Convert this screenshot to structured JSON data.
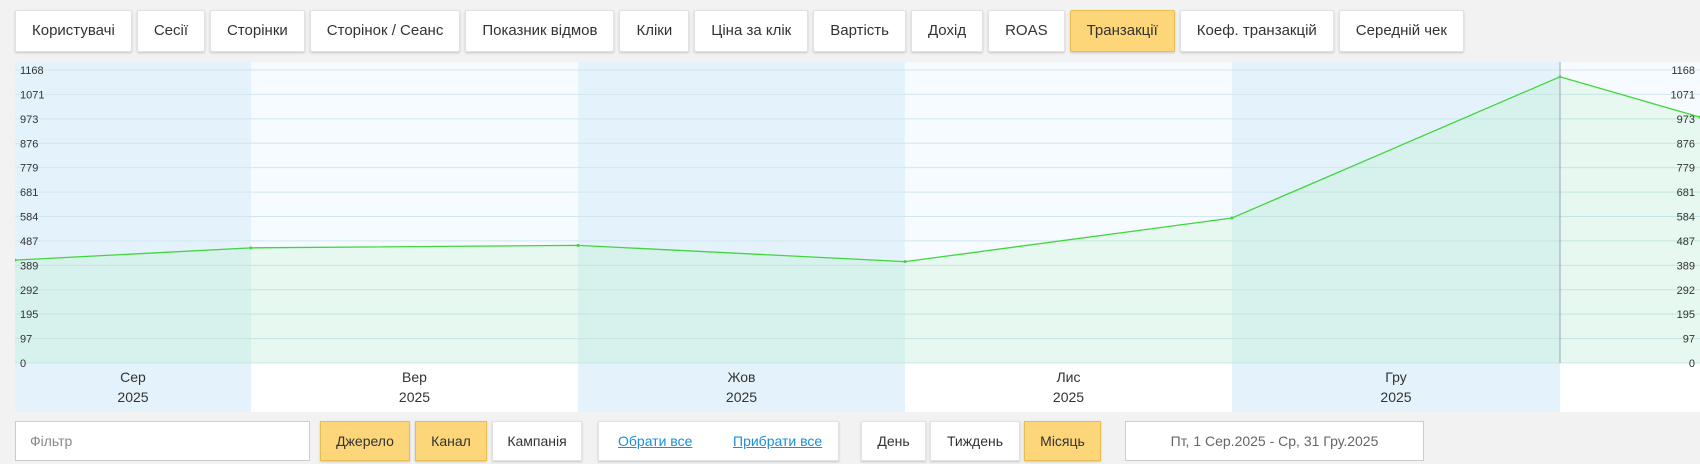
{
  "metric_tabs": [
    {
      "label": "Користувачі",
      "active": false
    },
    {
      "label": "Сесії",
      "active": false
    },
    {
      "label": "Сторінки",
      "active": false
    },
    {
      "label": "Сторінок / Сеанс",
      "active": false
    },
    {
      "label": "Показник відмов",
      "active": false
    },
    {
      "label": "Кліки",
      "active": false
    },
    {
      "label": "Ціна за клік",
      "active": false
    },
    {
      "label": "Вартість",
      "active": false
    },
    {
      "label": "Дохід",
      "active": false
    },
    {
      "label": "ROAS",
      "active": false
    },
    {
      "label": "Транзакції",
      "active": true
    },
    {
      "label": "Коеф. транзакцій",
      "active": false
    },
    {
      "label": "Середній чек",
      "active": false
    }
  ],
  "chart_data": {
    "type": "area",
    "ylim": [
      0,
      1168
    ],
    "y_ticks": [
      "1168",
      "1071",
      "973",
      "876",
      "779",
      "681",
      "584",
      "487",
      "389",
      "292",
      "195",
      "97",
      "0"
    ],
    "months": [
      {
        "month": "Сер",
        "year": "2025"
      },
      {
        "month": "Вер",
        "year": "2025"
      },
      {
        "month": "Жов",
        "year": "2025"
      },
      {
        "month": "Лис",
        "year": "2025"
      },
      {
        "month": "Гру",
        "year": "2025"
      }
    ],
    "series": [
      {
        "values": [
          410,
          459,
          469,
          404,
          578,
          1141,
          980
        ]
      }
    ],
    "colors": {
      "line": "#41d63c",
      "fill": "#41d63c",
      "band_shade": "#e4f3fb",
      "band_light": "#f5fbfe",
      "grid": "#d2e6f0"
    }
  },
  "controls": {
    "filter_placeholder": "Фільтр",
    "group_buttons": [
      {
        "label": "Джерело",
        "active": true
      },
      {
        "label": "Канал",
        "active": true
      },
      {
        "label": "Кампанія",
        "active": false
      }
    ],
    "select_all": "Обрати все",
    "deselect_all": "Прибрати все",
    "period_buttons": [
      {
        "label": "День",
        "active": false
      },
      {
        "label": "Тиждень",
        "active": false
      },
      {
        "label": "Місяць",
        "active": true
      }
    ],
    "date_range": "Пт, 1 Сер.2025 - Ср, 31 Гру.2025"
  }
}
